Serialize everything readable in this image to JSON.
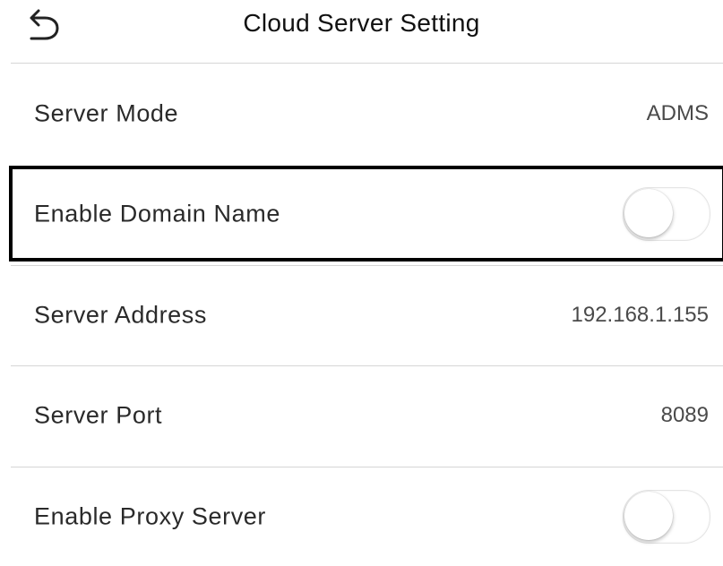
{
  "header": {
    "title": "Cloud Server Setting",
    "back_icon": "back-arrow-icon"
  },
  "rows": [
    {
      "label": "Server Mode",
      "value": "ADMS"
    },
    {
      "label": "Enable Domain Name",
      "toggle_on": false
    },
    {
      "label": "Server Address",
      "value": "192.168.1.155"
    },
    {
      "label": "Server Port",
      "value": "8089"
    },
    {
      "label": "Enable Proxy Server",
      "toggle_on": false
    }
  ],
  "colors": {
    "background": "#ffffff",
    "divider": "#d6d6d6",
    "highlight_border": "#000000"
  }
}
